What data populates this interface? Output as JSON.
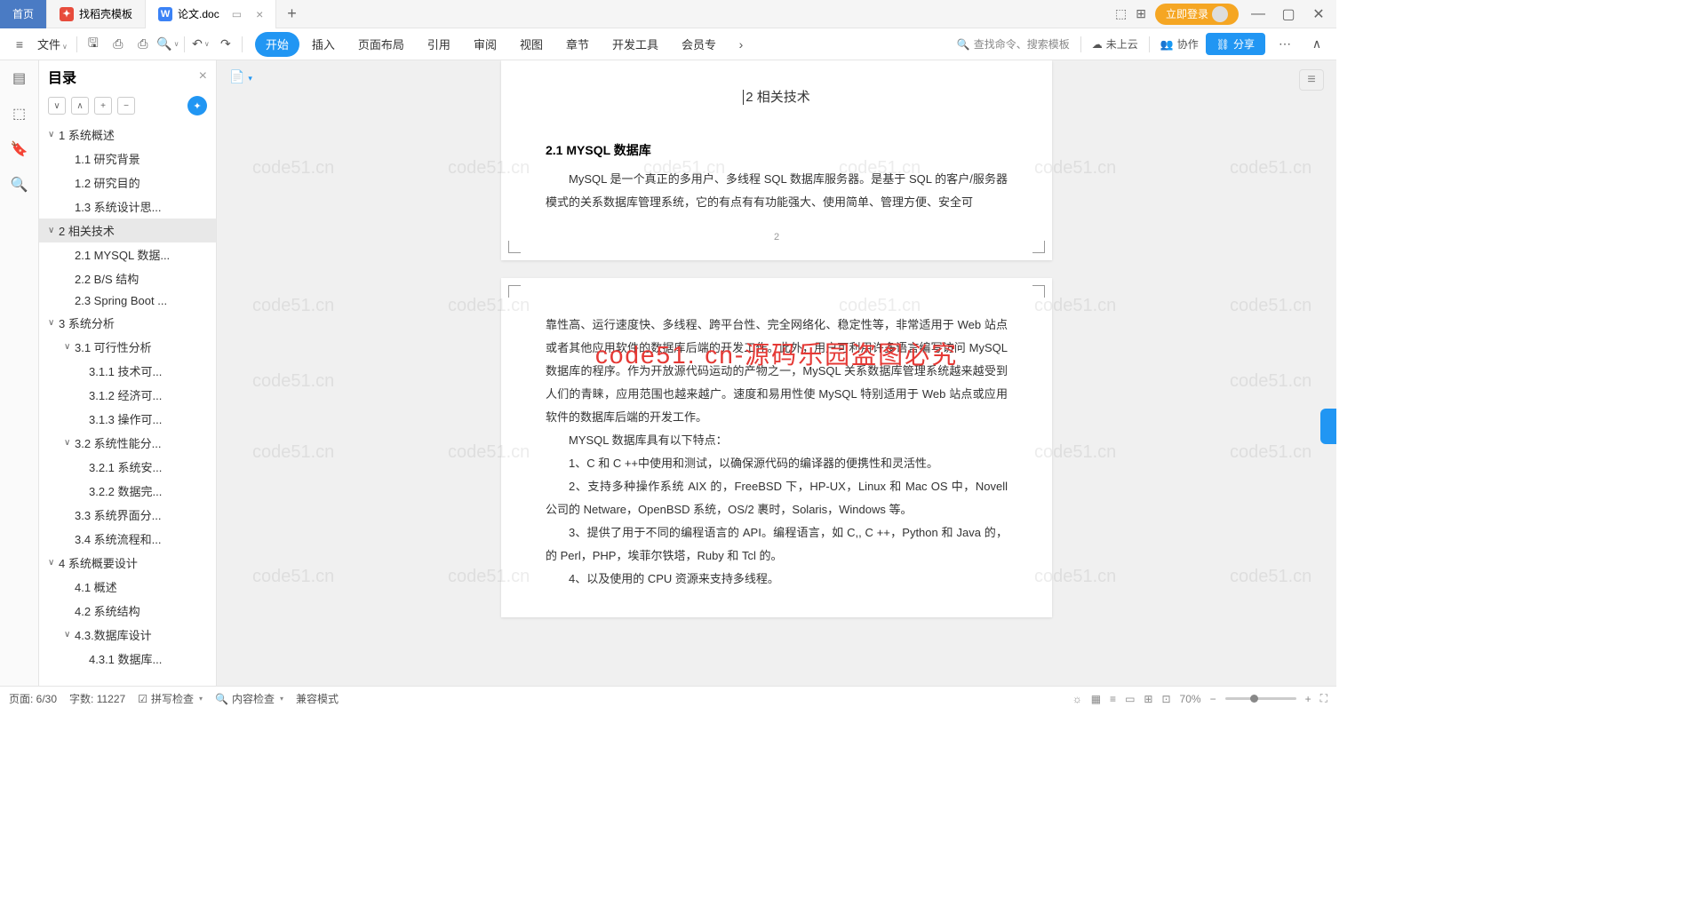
{
  "tabs": {
    "home": "首页",
    "template": "找稻壳模板",
    "doc": "论文.doc"
  },
  "topbar": {
    "login": "立即登录"
  },
  "menubar": {
    "file": "文件",
    "tabs": [
      "开始",
      "插入",
      "页面布局",
      "引用",
      "审阅",
      "视图",
      "章节",
      "开发工具",
      "会员专"
    ],
    "search_placeholder": "查找命令、搜索模板",
    "cloud": "未上云",
    "collab": "协作",
    "share": "分享"
  },
  "outline": {
    "title": "目录",
    "items": [
      {
        "lvl": 1,
        "chev": true,
        "text": "1 系统概述"
      },
      {
        "lvl": 2,
        "text": "1.1 研究背景"
      },
      {
        "lvl": 2,
        "text": "1.2 研究目的"
      },
      {
        "lvl": 2,
        "text": "1.3 系统设计思..."
      },
      {
        "lvl": 1,
        "chev": true,
        "text": "2 相关技术",
        "selected": true
      },
      {
        "lvl": 2,
        "text": "2.1 MYSQL 数据..."
      },
      {
        "lvl": 2,
        "text": "2.2 B/S 结构"
      },
      {
        "lvl": 2,
        "text": "2.3 Spring Boot ..."
      },
      {
        "lvl": 1,
        "chev": true,
        "text": "3 系统分析"
      },
      {
        "lvl": 2,
        "chev": true,
        "text": "3.1 可行性分析"
      },
      {
        "lvl": 3,
        "text": "3.1.1 技术可..."
      },
      {
        "lvl": 3,
        "text": "3.1.2 经济可..."
      },
      {
        "lvl": 3,
        "text": "3.1.3 操作可..."
      },
      {
        "lvl": 2,
        "chev": true,
        "text": "3.2 系统性能分..."
      },
      {
        "lvl": 3,
        "text": "3.2.1 系统安..."
      },
      {
        "lvl": 3,
        "text": "3.2.2 数据完..."
      },
      {
        "lvl": 2,
        "text": "3.3 系统界面分..."
      },
      {
        "lvl": 2,
        "text": "3.4 系统流程和..."
      },
      {
        "lvl": 1,
        "chev": true,
        "text": "4 系统概要设计"
      },
      {
        "lvl": 2,
        "text": "4.1 概述"
      },
      {
        "lvl": 2,
        "text": "4.2 系统结构"
      },
      {
        "lvl": 2,
        "chev": true,
        "text": "4.3.数据库设计"
      },
      {
        "lvl": 3,
        "text": "4.3.1 数据库..."
      }
    ]
  },
  "doc": {
    "heading": "2 相关技术",
    "h2_1": "2.1 MYSQL 数据库",
    "p1": "MySQL 是一个真正的多用户、多线程 SQL 数据库服务器。是基于 SQL 的客户/服务器模式的关系数据库管理系统，它的有点有有功能强大、使用简单、管理方便、安全可",
    "pagenum": "2",
    "p2": "靠性高、运行速度快、多线程、跨平台性、完全网络化、稳定性等，非常适用于 Web 站点或者其他应用软件的数据库后端的开发工作。此外，用户可利用许多语言编写访问 MySQL 数据库的程序。作为开放源代码运动的产物之一，MySQL 关系数据库管理系统越来越受到人们的青睐，应用范围也越来越广。速度和易用性使 MySQL 特别适用于 Web 站点或应用软件的数据库后端的开发工作。",
    "p3": "MYSQL 数据库具有以下特点：",
    "p4": "1、C 和 C ++中使用和测试，以确保源代码的编译器的便携性和灵活性。",
    "p5": "2、支持多种操作系统 AIX 的，FreeBSD 下，HP-UX，Linux 和 Mac OS 中，Novell 公司的 Netware，OpenBSD 系统，OS/2 裹时，Solaris，Windows 等。",
    "p6": "3、提供了用于不同的编程语言的 API。编程语言，如 C,, C ++，Python 和 Java 的，的 Perl，PHP，埃菲尔铁塔，Ruby 和 Tcl 的。",
    "p7": "4、以及使用的 CPU 资源来支持多线程。"
  },
  "watermark_banner": "code51. cn-源码乐园盗图必究",
  "faint_wm": "code51.cn",
  "status": {
    "page": "页面: 6/30",
    "words": "字数: 11227",
    "spell": "拼写检查",
    "content": "内容检查",
    "compat": "兼容模式",
    "zoom": "70%"
  }
}
